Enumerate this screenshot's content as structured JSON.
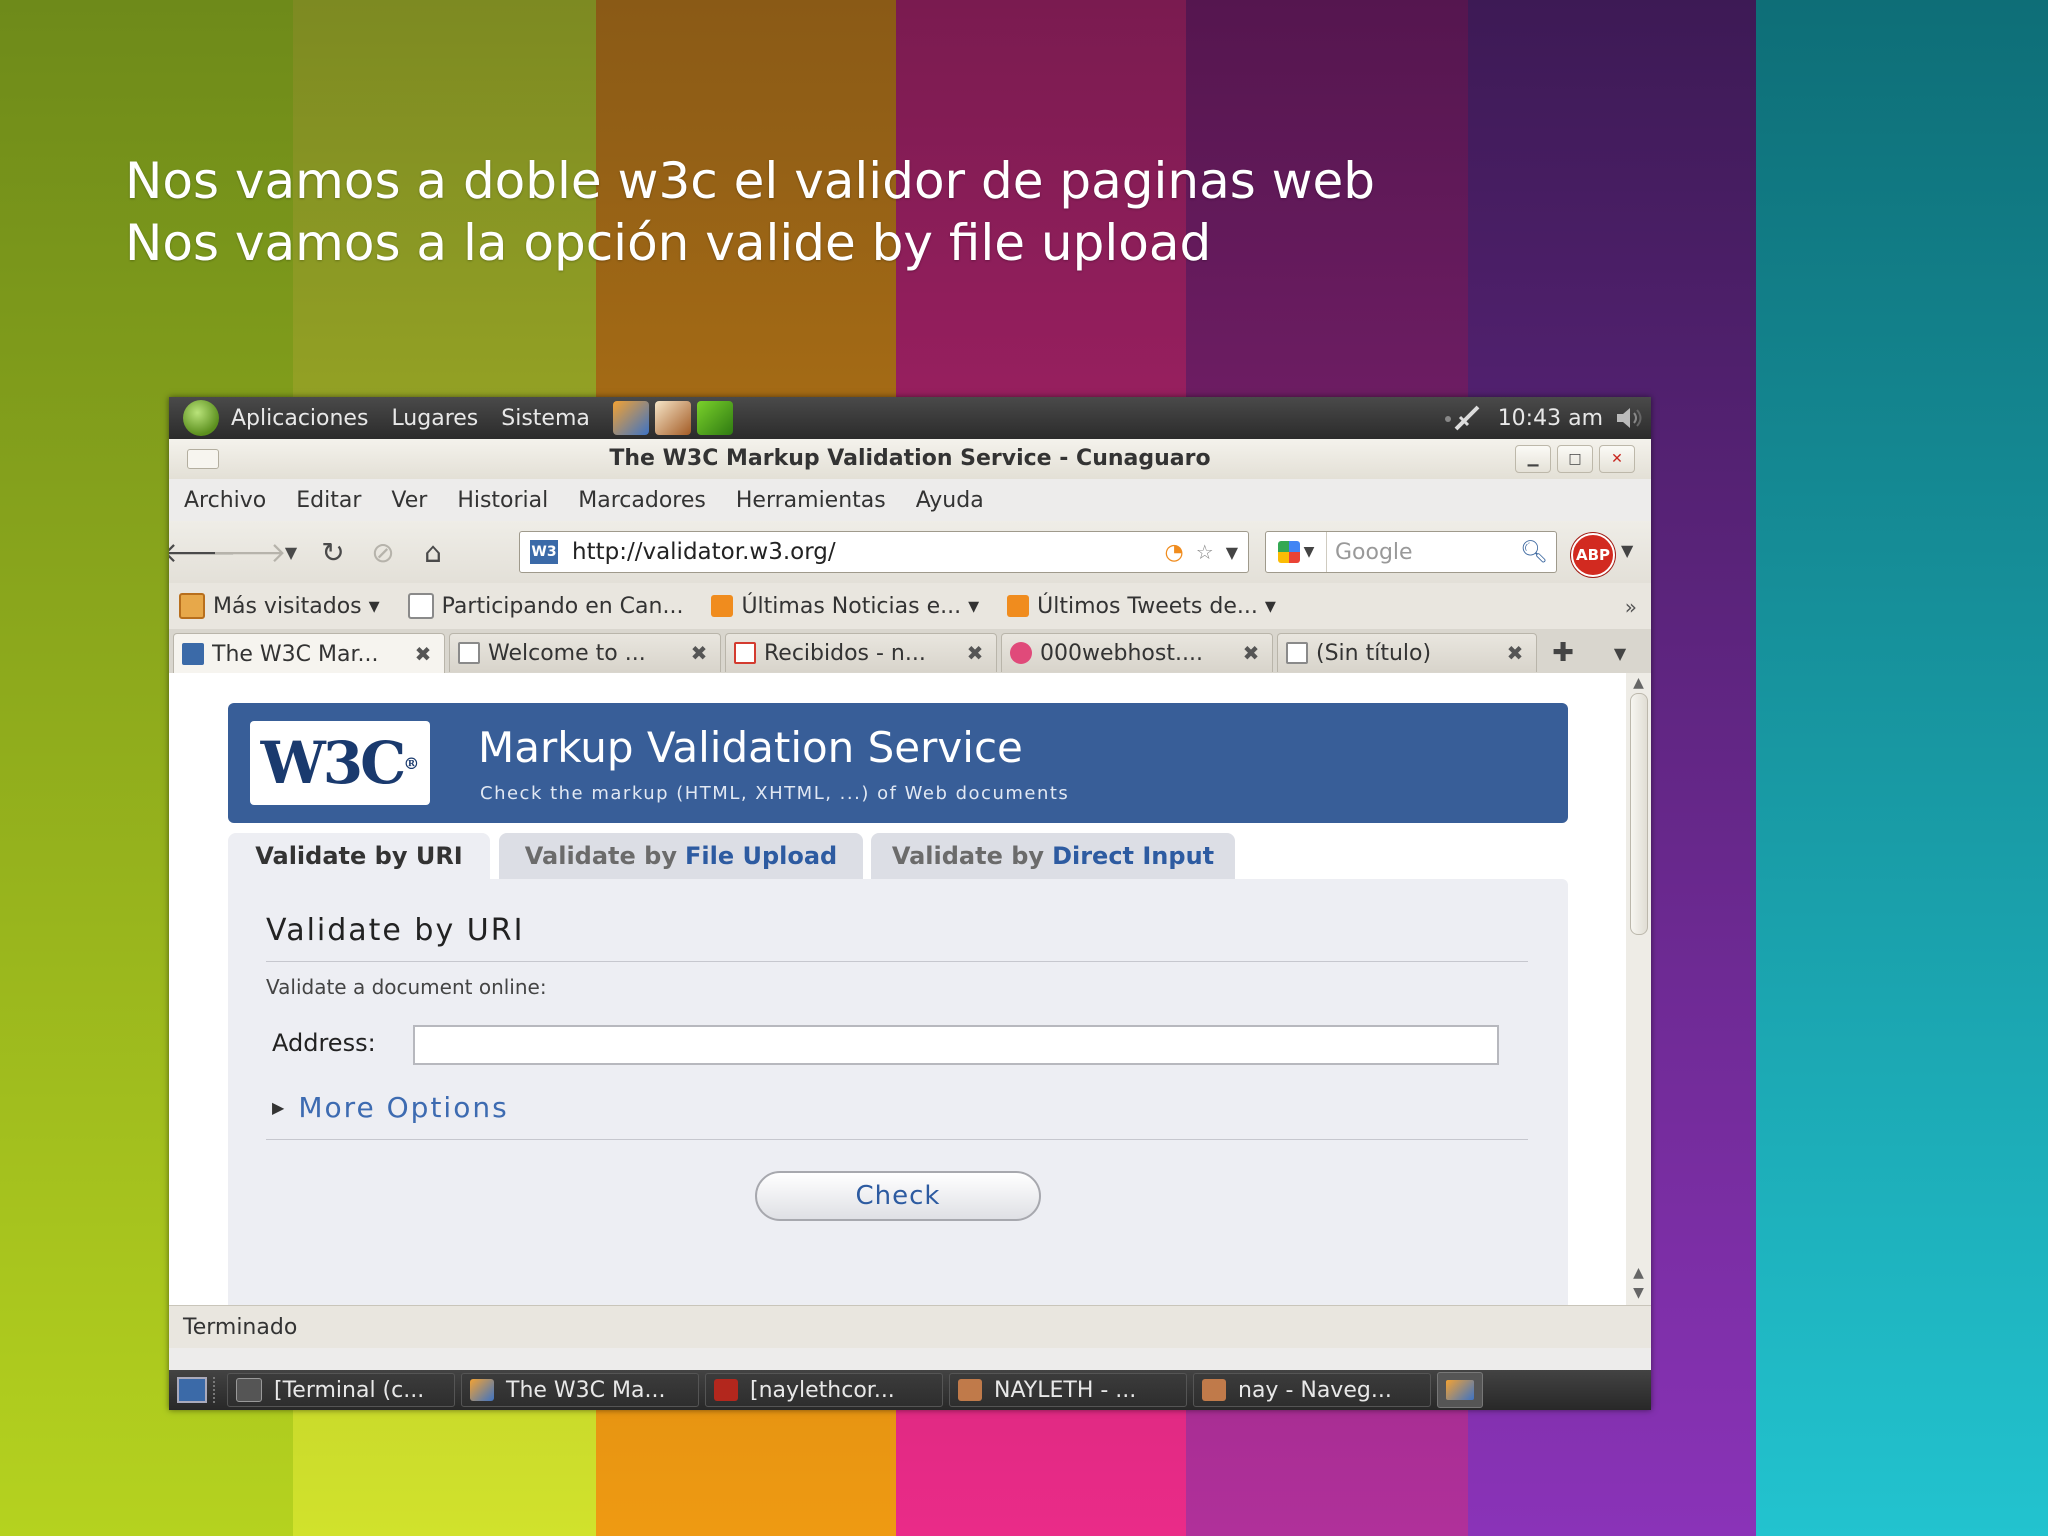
{
  "slide": {
    "line1": "Nos vamos a doble w3c el validor de paginas web",
    "line2": "Nos vamos a la opción valide by file upload",
    "stripes": [
      "#8fb51f",
      "#b9c92a",
      "#d98a12",
      "#d9237a",
      "#a12a8c",
      "#7a2aa3",
      "#1aa7b4"
    ]
  },
  "top_panel": {
    "menus": [
      "Aplicaciones",
      "Lugares",
      "Sistema"
    ],
    "launchers": [
      "firefox-launcher-icon",
      "thunderbird-launcher-icon",
      "evolution-launcher-icon"
    ],
    "clock": "10:43 am"
  },
  "window": {
    "title": "The W3C Markup Validation Service - Cunaguaro"
  },
  "menubar": [
    "Archivo",
    "Editar",
    "Ver",
    "Historial",
    "Marcadores",
    "Herramientas",
    "Ayuda"
  ],
  "navigation": {
    "url": "http://validator.w3.org/",
    "search_placeholder": "Google",
    "adblock_label": "ABP"
  },
  "bookmarks": [
    {
      "label": "Más visitados ▾",
      "icon": "folder"
    },
    {
      "label": "Participando en Can...",
      "icon": "page"
    },
    {
      "label": "Últimas Noticias e... ▾",
      "icon": "rss"
    },
    {
      "label": "Últimos Tweets de... ▾",
      "icon": "rss"
    }
  ],
  "tabs": [
    {
      "label": "The W3C Mar...",
      "icon_color": "#3b6aa8"
    },
    {
      "label": "Welcome to ...",
      "icon_color": "#8a8a8a"
    },
    {
      "label": "Recibidos - n...",
      "icon_color": "#d33b2f"
    },
    {
      "label": "000webhost....",
      "icon_color": "#e04a7a"
    },
    {
      "label": "(Sin título)",
      "icon_color": "#8a8a8a"
    }
  ],
  "page": {
    "logo_text": "W3C",
    "logo_mark": "®",
    "banner_title": "Markup Validation Service",
    "banner_subtitle": "Check the markup (HTML, XHTML, ...) of Web documents",
    "tabs": [
      {
        "prefix": "Validate by",
        "highlight": "URI"
      },
      {
        "prefix": "Validate by",
        "highlight": "File Upload"
      },
      {
        "prefix": "Validate by",
        "highlight": "Direct Input"
      }
    ],
    "section_title": "Validate by URI",
    "description": "Validate a document online:",
    "address_label": "Address:",
    "address_value": "",
    "more_options": "More Options",
    "check_button": "Check"
  },
  "status": "Terminado",
  "taskbar": [
    {
      "label": "[Terminal (c...",
      "icon_color": "#555555"
    },
    {
      "label": "The W3C Ma...",
      "icon_color": "#e07b24"
    },
    {
      "label": "[naylethcor...",
      "icon_color": "#c0392b"
    },
    {
      "label": "NAYLETH - ...",
      "icon_color": "#c07a4a"
    },
    {
      "label": "nay - Naveg...",
      "icon_color": "#c07a4a"
    }
  ]
}
